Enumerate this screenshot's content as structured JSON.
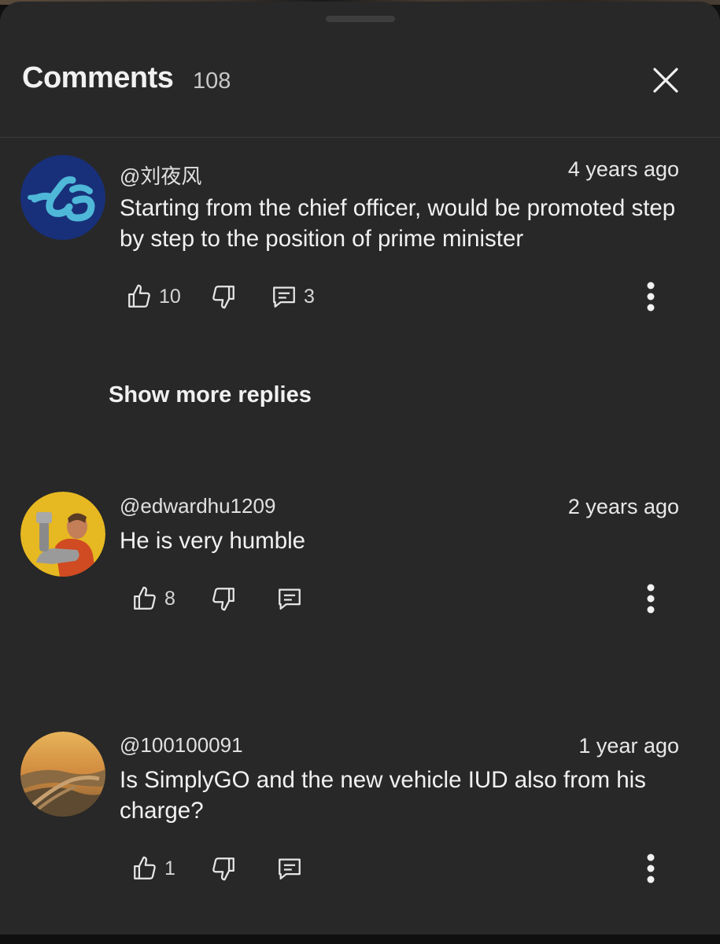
{
  "header": {
    "title": "Comments",
    "count": "108"
  },
  "comments": [
    {
      "handle": "@刘夜风",
      "time": "4 years ago",
      "text": "Starting from the chief officer, would be promoted step by step to the position of prime minister",
      "likes": "10",
      "replies": "3",
      "avatar_colors": {
        "bg": "#18307a",
        "accent": "#4fb8d8"
      }
    },
    {
      "handle": "@edwardhu1209",
      "time": "2 years ago",
      "text": "He is very humble",
      "likes": "8",
      "replies": "",
      "avatar_colors": {
        "bg": "#e6b821",
        "accent": "#d04a22"
      }
    },
    {
      "handle": "@100100091",
      "time": "1 year ago",
      "text": "Is SimplyGO and the new vehicle IUD also from his charge?",
      "likes": "1",
      "replies": "",
      "avatar_colors": {
        "bg": "#c88a3c",
        "accent": "#6d5a3a"
      }
    }
  ],
  "show_more_replies": "Show more replies",
  "icons": {
    "like": "thumbs-up-icon",
    "dislike": "thumbs-down-icon",
    "reply": "comment-icon",
    "more": "more-vertical-icon",
    "close": "close-icon"
  },
  "colors": {
    "sheet_bg": "#282828",
    "text_primary": "#f1f1f1",
    "text_secondary": "#c8c8c8"
  }
}
